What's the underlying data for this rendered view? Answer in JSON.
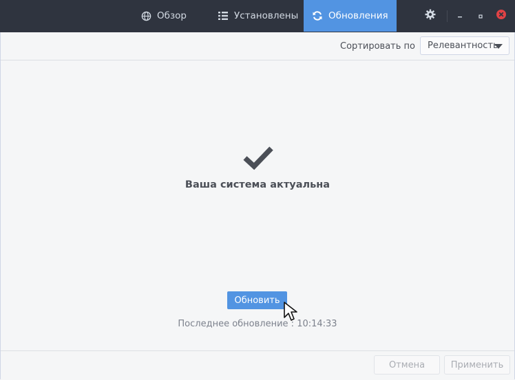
{
  "header": {
    "tabs": [
      {
        "label": "Обзор",
        "icon": "globe-icon",
        "active": false
      },
      {
        "label": "Установлены",
        "icon": "list-icon",
        "active": false
      },
      {
        "label": "Обновления",
        "icon": "refresh-icon",
        "active": true
      }
    ],
    "accent_color": "#5294e2",
    "bar_color": "#2f343f"
  },
  "toolbar": {
    "sort_label": "Сортировать по",
    "sort_value": "Релевантность"
  },
  "main": {
    "status_icon": "checkmark-icon",
    "status_title": "Ваша система актуальна",
    "refresh_button": "Обновить",
    "last_update": "Последнее обновление : 10:14:33"
  },
  "footer": {
    "cancel_label": "Отмена",
    "apply_label": "Применить"
  }
}
